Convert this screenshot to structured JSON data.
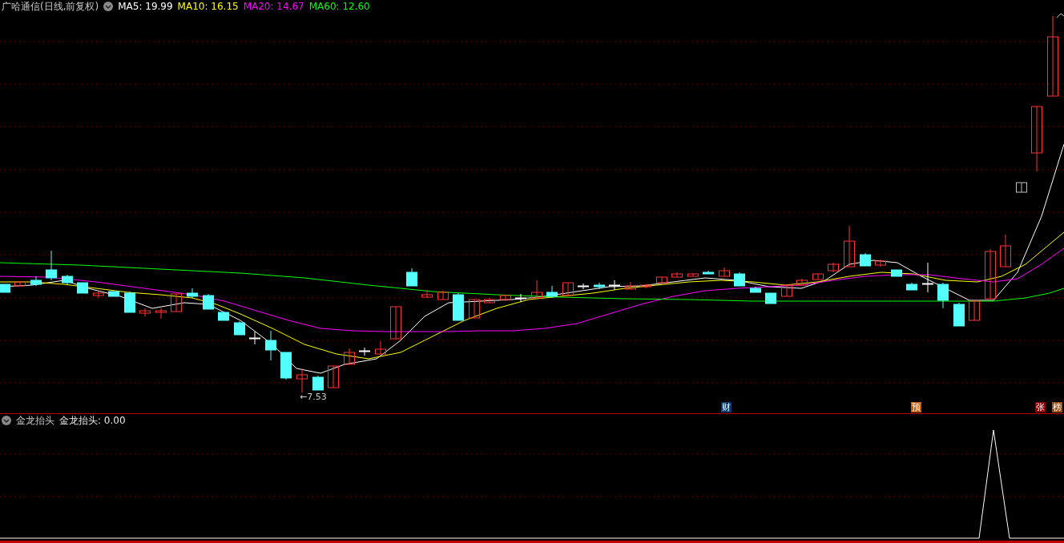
{
  "main_chart": {
    "title": "广哈通信(日线,前复权)",
    "ma_legend": [
      {
        "label": "MA5: 19.99",
        "color": "#ffffff"
      },
      {
        "label": "MA10: 16.15",
        "color": "#ffff00"
      },
      {
        "label": "MA20: 14.67",
        "color": "#ff00ff"
      },
      {
        "label": "MA60: 12.60",
        "color": "#00ff00"
      }
    ],
    "low_label": "←7.53",
    "event_markers": [
      {
        "text": "财",
        "color": "#0c3a6b"
      },
      {
        "text": "预",
        "color": "#c65a0e"
      },
      {
        "text": "张",
        "color": "#8b0000"
      },
      {
        "text": "榜",
        "color": "#9b4d0c"
      }
    ]
  },
  "indicator": {
    "title": "金龙抬头",
    "reading": "金龙抬头: 0.00"
  }
}
